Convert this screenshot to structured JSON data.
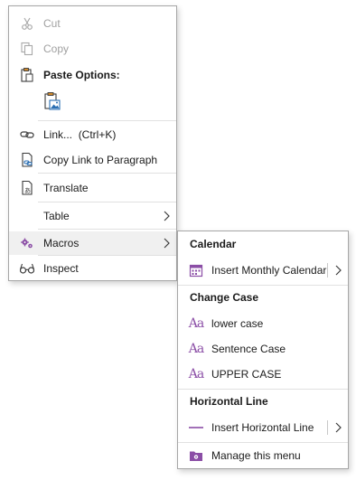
{
  "main_menu": {
    "cut": {
      "label": "Cut",
      "icon": "scissors-icon",
      "enabled": false
    },
    "copy": {
      "label": "Copy",
      "icon": "copy-icon",
      "enabled": false
    },
    "paste_options": {
      "header": "Paste Options:",
      "icon": "clipboard-icon",
      "option_icon": "paste-picture-icon"
    },
    "link": {
      "label": "Link...",
      "shortcut": "(Ctrl+K)",
      "icon": "link-icon"
    },
    "copy_link_paragraph": {
      "label": "Copy Link to Paragraph",
      "icon": "copy-link-icon"
    },
    "translate": {
      "label": "Translate",
      "icon": "translate-icon"
    },
    "table": {
      "label": "Table",
      "has_submenu": true
    },
    "macros": {
      "label": "Macros",
      "icon": "gears-icon",
      "has_submenu": true,
      "highlighted": true
    },
    "inspect": {
      "label": "Inspect",
      "icon": "glasses-icon"
    }
  },
  "macros_submenu": {
    "calendar_header": "Calendar",
    "insert_monthly_calendar": {
      "label": "Insert Monthly Calendar",
      "icon": "calendar-icon",
      "has_submenu": true
    },
    "change_case_header": "Change Case",
    "lower_case": {
      "label": "lower case",
      "icon": "text-case-icon"
    },
    "sentence_case": {
      "label": "Sentence Case",
      "icon": "text-case-icon"
    },
    "upper_case": {
      "label": "UPPER CASE",
      "icon": "text-case-icon"
    },
    "horizontal_line_header": "Horizontal Line",
    "insert_horizontal_line": {
      "label": "Insert Horizontal Line",
      "icon": "horizontal-line-icon",
      "has_submenu": true
    },
    "manage_menu": {
      "label": "Manage this menu",
      "icon": "folder-gear-icon"
    }
  },
  "colors": {
    "accent_purple": "#8b4ea6",
    "disabled_text": "#a0a0a0",
    "hover_bg": "#f0f0f0",
    "border": "#a6a6a6"
  }
}
